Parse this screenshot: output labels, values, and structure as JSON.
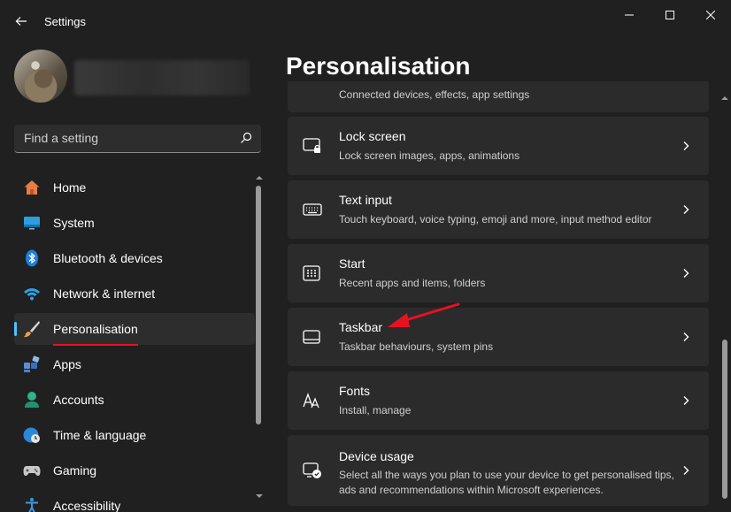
{
  "window": {
    "title": "Settings"
  },
  "search": {
    "placeholder": "Find a setting"
  },
  "page": {
    "title": "Personalisation"
  },
  "nav": {
    "items": [
      {
        "label": "Home",
        "icon": "home-icon"
      },
      {
        "label": "System",
        "icon": "monitor-icon"
      },
      {
        "label": "Bluetooth & devices",
        "icon": "bluetooth-icon"
      },
      {
        "label": "Network & internet",
        "icon": "wifi-icon"
      },
      {
        "label": "Personalisation",
        "icon": "brush-icon",
        "selected": true
      },
      {
        "label": "Apps",
        "icon": "apps-icon"
      },
      {
        "label": "Accounts",
        "icon": "person-icon"
      },
      {
        "label": "Time & language",
        "icon": "globe-clock-icon"
      },
      {
        "label": "Gaming",
        "icon": "gamepad-icon"
      },
      {
        "label": "Accessibility",
        "icon": "accessibility-icon"
      }
    ]
  },
  "cards": [
    {
      "title": "",
      "subtitle": "Connected devices, effects, app settings",
      "icon": ""
    },
    {
      "title": "Lock screen",
      "subtitle": "Lock screen images, apps, animations",
      "icon": "lock-screen-icon"
    },
    {
      "title": "Text input",
      "subtitle": "Touch keyboard, voice typing, emoji and more, input method editor",
      "icon": "keyboard-icon"
    },
    {
      "title": "Start",
      "subtitle": "Recent apps and items, folders",
      "icon": "start-icon"
    },
    {
      "title": "Taskbar",
      "subtitle": "Taskbar behaviours, system pins",
      "icon": "taskbar-icon"
    },
    {
      "title": "Fonts",
      "subtitle": "Install, manage",
      "icon": "fonts-icon"
    },
    {
      "title": "Device usage",
      "subtitle": "Select all the ways you plan to use your device to get personalised tips, ads and recommendations within Microsoft experiences.",
      "icon": "device-usage-icon"
    }
  ],
  "colors": {
    "accent": "#4cc2ff",
    "annotation": "#e81123",
    "background": "#202020",
    "card": "#2b2b2b"
  }
}
